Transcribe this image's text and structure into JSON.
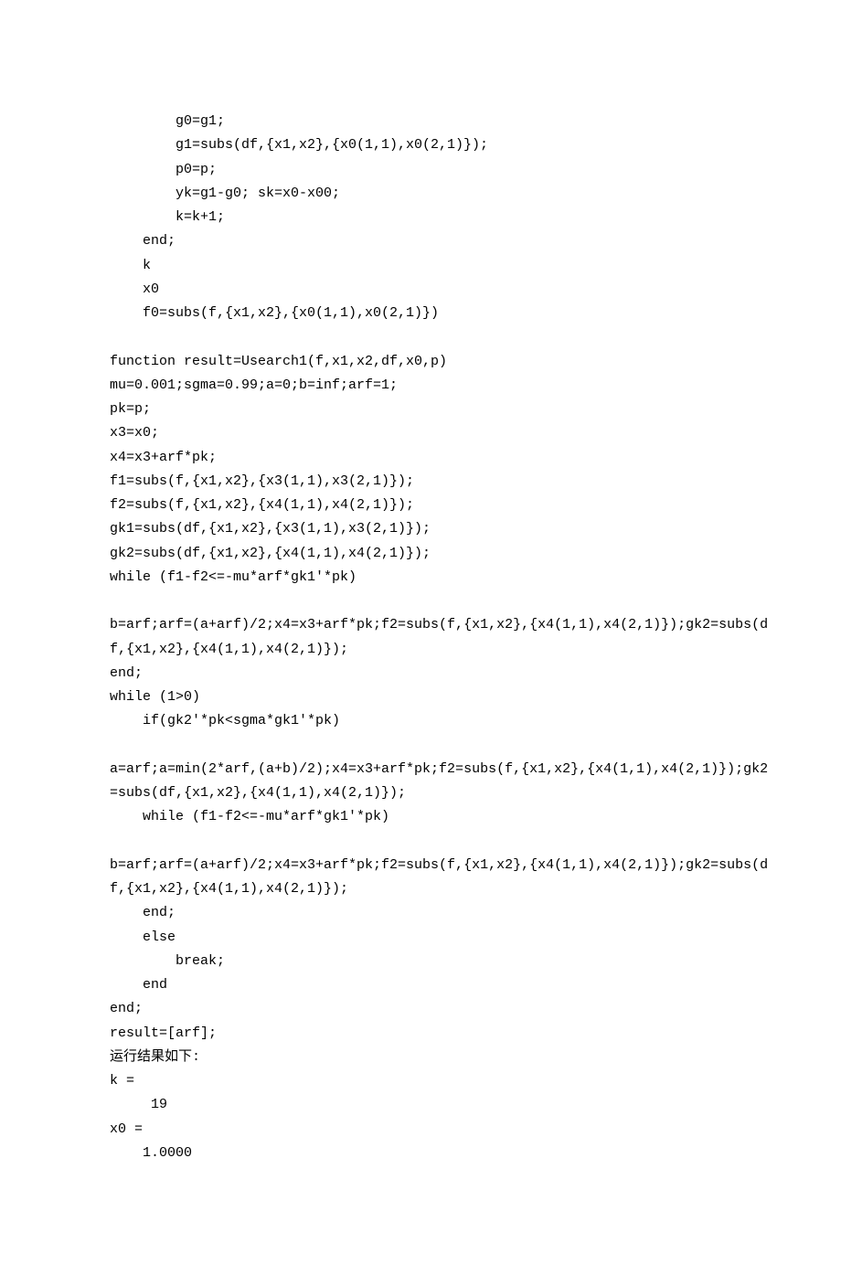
{
  "lines": [
    {
      "cls": "ind2",
      "text": "g0=g1;"
    },
    {
      "cls": "ind2",
      "text": "g1=subs(df,{x1,x2},{x0(1,1),x0(2,1)});"
    },
    {
      "cls": "ind2",
      "text": "p0=p;"
    },
    {
      "cls": "ind2",
      "text": "yk=g1-g0; sk=x0-x00;"
    },
    {
      "cls": "ind2",
      "text": "k=k+1;"
    },
    {
      "cls": "ind1",
      "text": "end;"
    },
    {
      "cls": "ind1",
      "text": "k"
    },
    {
      "cls": "ind1",
      "text": "x0"
    },
    {
      "cls": "ind1",
      "text": "f0=subs(f,{x1,x2},{x0(1,1),x0(2,1)})"
    },
    {
      "cls": "",
      "text": " "
    },
    {
      "cls": "",
      "text": "function result=Usearch1(f,x1,x2,df,x0,p)"
    },
    {
      "cls": "",
      "text": "mu=0.001;sgma=0.99;a=0;b=inf;arf=1;"
    },
    {
      "cls": "",
      "text": "pk=p;"
    },
    {
      "cls": "",
      "text": "x3=x0;"
    },
    {
      "cls": "",
      "text": "x4=x3+arf*pk;"
    },
    {
      "cls": "",
      "text": "f1=subs(f,{x1,x2},{x3(1,1),x3(2,1)});"
    },
    {
      "cls": "",
      "text": "f2=subs(f,{x1,x2},{x4(1,1),x4(2,1)});"
    },
    {
      "cls": "",
      "text": "gk1=subs(df,{x1,x2},{x3(1,1),x3(2,1)});"
    },
    {
      "cls": "",
      "text": "gk2=subs(df,{x1,x2},{x4(1,1),x4(2,1)});"
    },
    {
      "cls": "",
      "text": "while (f1-f2<=-mu*arf*gk1'*pk)"
    },
    {
      "cls": "",
      "text": " "
    },
    {
      "cls": "",
      "text": "b=arf;arf=(a+arf)/2;x4=x3+arf*pk;f2=subs(f,{x1,x2},{x4(1,1),x4(2,1)});gk2=subs(d"
    },
    {
      "cls": "",
      "text": "f,{x1,x2},{x4(1,1),x4(2,1)});"
    },
    {
      "cls": "",
      "text": "end;"
    },
    {
      "cls": "",
      "text": "while (1>0)"
    },
    {
      "cls": "ind1",
      "text": "if(gk2'*pk<sgma*gk1'*pk)"
    },
    {
      "cls": "",
      "text": " "
    },
    {
      "cls": "",
      "text": "a=arf;a=min(2*arf,(a+b)/2);x4=x3+arf*pk;f2=subs(f,{x1,x2},{x4(1,1),x4(2,1)});gk2"
    },
    {
      "cls": "",
      "text": "=subs(df,{x1,x2},{x4(1,1),x4(2,1)});"
    },
    {
      "cls": "ind1",
      "text": "while (f1-f2<=-mu*arf*gk1'*pk)"
    },
    {
      "cls": "",
      "text": " "
    },
    {
      "cls": "",
      "text": "b=arf;arf=(a+arf)/2;x4=x3+arf*pk;f2=subs(f,{x1,x2},{x4(1,1),x4(2,1)});gk2=subs(d"
    },
    {
      "cls": "",
      "text": "f,{x1,x2},{x4(1,1),x4(2,1)});"
    },
    {
      "cls": "ind1",
      "text": "end;"
    },
    {
      "cls": "ind1",
      "text": "else"
    },
    {
      "cls": "ind2",
      "text": "break;"
    },
    {
      "cls": "ind1",
      "text": "end"
    },
    {
      "cls": "",
      "text": "end;"
    },
    {
      "cls": "",
      "text": "result=[arf];"
    },
    {
      "cls": "",
      "text": "运行结果如下:"
    },
    {
      "cls": "",
      "text": "k ="
    },
    {
      "cls": "ind-res",
      "text": "19"
    },
    {
      "cls": "",
      "text": "x0 ="
    },
    {
      "cls": "ind-val",
      "text": "1.0000"
    }
  ]
}
